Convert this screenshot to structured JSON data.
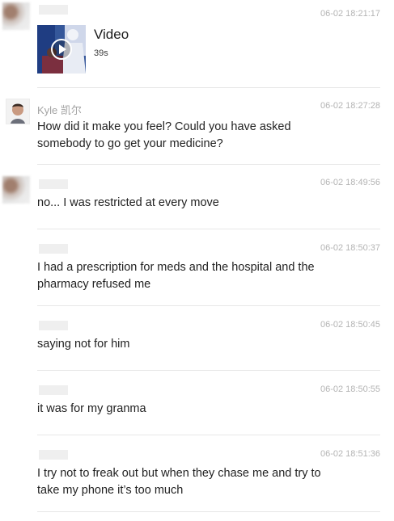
{
  "messages": [
    {
      "sender": "",
      "time": "06-02 18:21:17",
      "type": "video",
      "label": "Video",
      "duration": "39s"
    },
    {
      "sender": "Kyle 凯尔",
      "time": "06-02 18:27:28",
      "type": "text",
      "lines": [
        "How did it make you feel? Could you have asked",
        "somebody to go get your medicine?"
      ]
    },
    {
      "sender": "",
      "time": "06-02 18:49:56",
      "type": "text",
      "lines": [
        "no...  I was restricted at every move"
      ]
    },
    {
      "sender": "",
      "time": "06-02 18:50:37",
      "type": "text",
      "lines": [
        "I had a prescription for meds and the hospital and the",
        "pharmacy refused me"
      ]
    },
    {
      "sender": "",
      "time": "06-02 18:50:45",
      "type": "text",
      "lines": [
        "saying not for him"
      ]
    },
    {
      "sender": "",
      "time": "06-02 18:50:55",
      "type": "text",
      "lines": [
        "it was for my granma"
      ]
    },
    {
      "sender": "",
      "time": "06-02 18:51:36",
      "type": "text",
      "lines": [
        "I try not to freak out but when they chase me and try to",
        "take my phone it’s too much"
      ]
    }
  ],
  "icons": {
    "play": "play-icon",
    "avatar": "avatar-icon"
  }
}
